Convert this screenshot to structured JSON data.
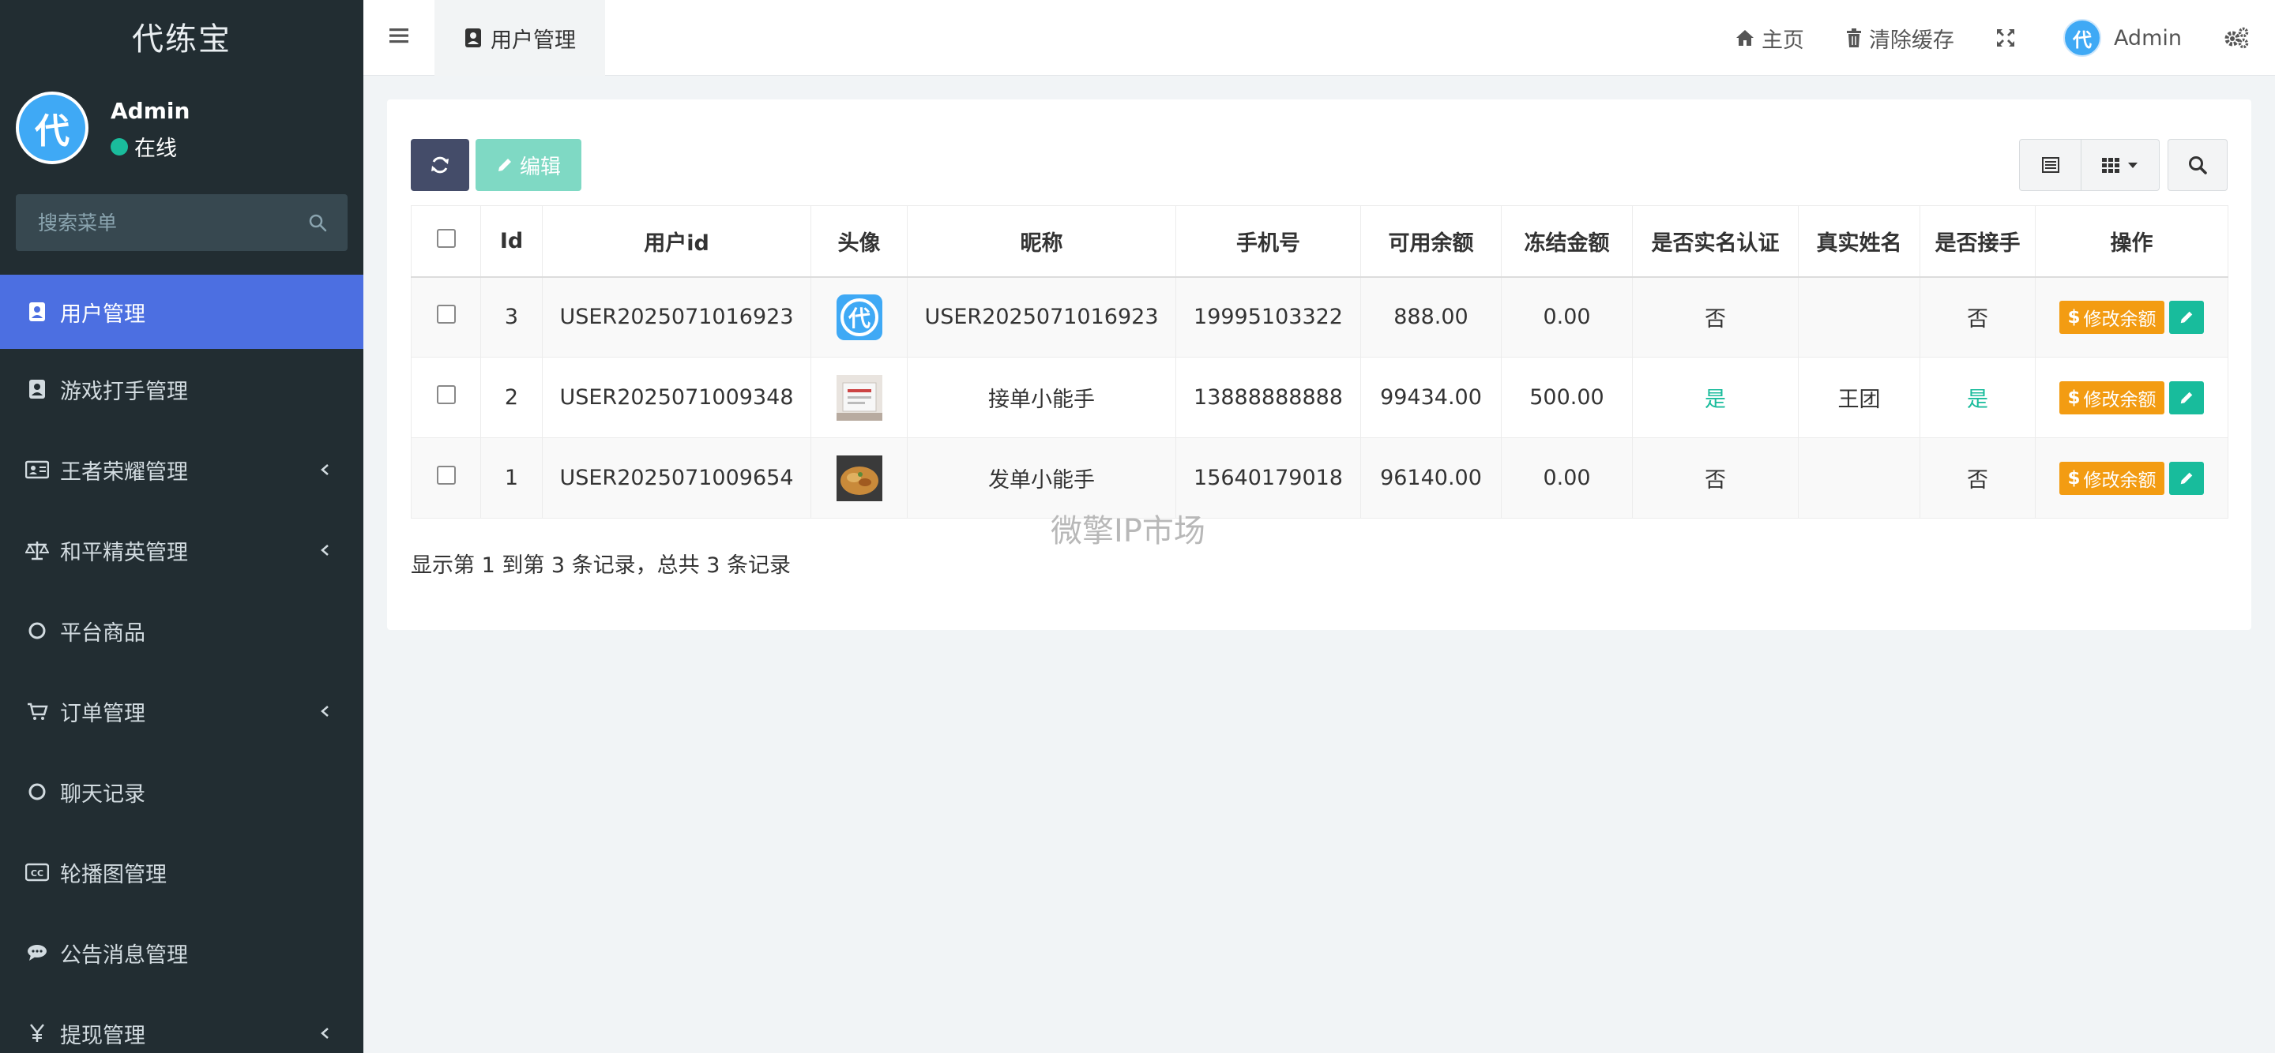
{
  "app": {
    "logo_text": "代练宝",
    "avatar_char": "代"
  },
  "sidebar": {
    "user": {
      "name": "Admin",
      "status": "在线"
    },
    "search_placeholder": "搜索菜单",
    "items": [
      {
        "label": "用户管理",
        "icon": "user-card-icon",
        "active": true,
        "expandable": false
      },
      {
        "label": "游戏打手管理",
        "icon": "user-card-icon",
        "active": false,
        "expandable": false
      },
      {
        "label": "王者荣耀管理",
        "icon": "id-card-icon",
        "active": false,
        "expandable": true
      },
      {
        "label": "和平精英管理",
        "icon": "balance-scale-icon",
        "active": false,
        "expandable": true
      },
      {
        "label": "平台商品",
        "icon": "circle-icon",
        "active": false,
        "expandable": false
      },
      {
        "label": "订单管理",
        "icon": "cart-icon",
        "active": false,
        "expandable": true
      },
      {
        "label": "聊天记录",
        "icon": "circle-icon",
        "active": false,
        "expandable": false
      },
      {
        "label": "轮播图管理",
        "icon": "cc-icon",
        "active": false,
        "expandable": false
      },
      {
        "label": "公告消息管理",
        "icon": "comment-icon",
        "active": false,
        "expandable": false
      },
      {
        "label": "提现管理",
        "icon": "yen-icon",
        "active": false,
        "expandable": true
      }
    ]
  },
  "header": {
    "tab_label": "用户管理",
    "home_label": "主页",
    "clear_cache_label": "清除缓存",
    "admin_label": "Admin"
  },
  "toolbar": {
    "edit_label": "编辑"
  },
  "table": {
    "columns": [
      "Id",
      "用户id",
      "头像",
      "昵称",
      "手机号",
      "可用余额",
      "冻结金额",
      "是否实名认证",
      "真实姓名",
      "是否接手",
      "操作"
    ],
    "rows": [
      {
        "id": "3",
        "user_id": "USER2025071016923",
        "avatar": "logo-avatar",
        "nickname": "USER2025071016923",
        "phone": "19995103322",
        "balance": "888.00",
        "frozen": "0.00",
        "verified": "否",
        "real_name": "",
        "taker": "否"
      },
      {
        "id": "2",
        "user_id": "USER2025071009348",
        "avatar": "photo-avatar",
        "nickname": "接单小能手",
        "phone": "13888888888",
        "balance": "99434.00",
        "frozen": "500.00",
        "verified": "是",
        "real_name": "王团",
        "taker": "是"
      },
      {
        "id": "1",
        "user_id": "USER2025071009654",
        "avatar": "food-avatar",
        "nickname": "发单小能手",
        "phone": "15640179018",
        "balance": "96140.00",
        "frozen": "0.00",
        "verified": "否",
        "real_name": "",
        "taker": "否"
      }
    ],
    "action_label": "修改余额",
    "yes_text": "是"
  },
  "pager_text": "显示第 1 到第 3 条记录，总共 3 条记录",
  "watermark": "微擎IP市场",
  "colors": {
    "sidebar_bg": "#222d32",
    "active_item": "#4c6fe1",
    "refresh_btn": "#444c69",
    "edit_btn": "#7fd9c4",
    "money_btn": "#f39c12",
    "pencil_btn": "#18bc9c",
    "yes_text": "#1abc9c"
  }
}
